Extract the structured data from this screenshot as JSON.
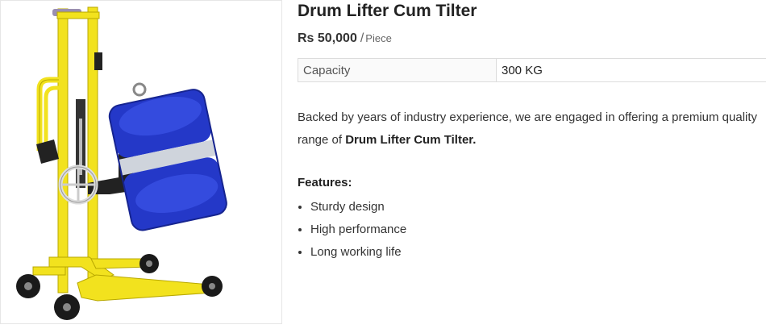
{
  "product": {
    "image_alt": "Drum Lifter Cum Tilter",
    "title": "Drum Lifter Cum Tilter",
    "price": "Rs 50,000",
    "price_separator": "/",
    "price_unit": "Piece",
    "specs": [
      {
        "key": "Capacity",
        "value": "300 KG"
      }
    ],
    "description_prefix": "Backed by years of industry experience, we are engaged in offering a premium quality range of ",
    "description_bold": "Drum Lifter Cum Tilter.",
    "features_heading": "Features:",
    "features": [
      "Sturdy design",
      "High performance",
      "Long working life"
    ]
  },
  "colors": {
    "frame": "#f2e21e",
    "drum": "#2438c8",
    "wheel": "#1a1a1a"
  }
}
